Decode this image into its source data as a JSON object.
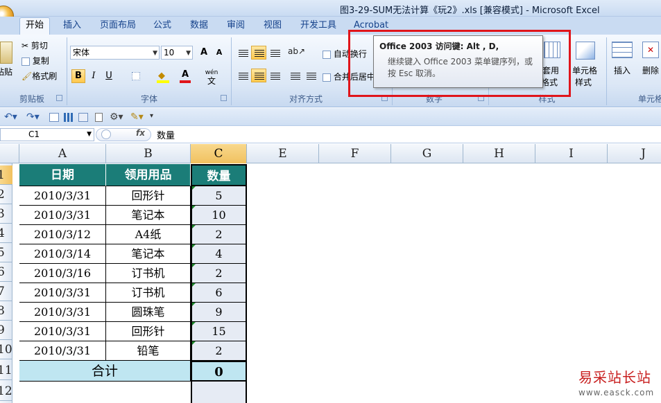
{
  "window": {
    "title": "图3-29-SUM无法计算《玩2》.xls [兼容模式] - Microsoft Excel"
  },
  "tabs": [
    "开始",
    "插入",
    "页面布局",
    "公式",
    "数据",
    "审阅",
    "视图",
    "开发工具",
    "Acrobat"
  ],
  "active_tab": "开始",
  "ribbon": {
    "clipboard": {
      "label": "剪贴板",
      "paste": "粘贴",
      "cut": "剪切",
      "copy": "复制",
      "format_painter": "格式刷"
    },
    "font": {
      "label": "字体",
      "font_name": "宋体",
      "font_size": "10",
      "bold": "B",
      "italic": "I",
      "underline": "U",
      "grow": "A",
      "shrink": "A",
      "font_color": "A",
      "phonetic": "wén"
    },
    "alignment": {
      "label": "对齐方式",
      "wrap_text": "自动换行",
      "merge_center": "合并后居中"
    },
    "number": {
      "label": "数字"
    },
    "styles": {
      "label": "样式",
      "table_format_1": "套用",
      "table_format_2": "表格格式",
      "cell_styles_1": "单元格",
      "cell_styles_2": "样式"
    },
    "cells": {
      "label": "单元格",
      "insert": "插入",
      "delete": "删除"
    }
  },
  "tooltip": {
    "title": "Office 2003 访问键: Alt , D,",
    "body": "继续键入 Office 2003 菜单键序列，或按 Esc 取消。"
  },
  "formula_bar": {
    "name_box": "C1",
    "fx": "fx",
    "formula": "数量"
  },
  "columns": [
    "A",
    "B",
    "C",
    "E",
    "F",
    "G",
    "H",
    "I",
    "J"
  ],
  "rows": [
    "1",
    "2",
    "3",
    "4",
    "5",
    "6",
    "7",
    "8",
    "9",
    "10",
    "11",
    "12"
  ],
  "table": {
    "headers": [
      "日期",
      "领用用品",
      "数量"
    ],
    "rows": [
      [
        "2010/3/31",
        "回形针",
        "5"
      ],
      [
        "2010/3/31",
        "笔记本",
        "10"
      ],
      [
        "2010/3/12",
        "A4纸",
        "2"
      ],
      [
        "2010/3/14",
        "笔记本",
        "4"
      ],
      [
        "2010/3/16",
        "订书机",
        "2"
      ],
      [
        "2010/3/31",
        "订书机",
        "6"
      ],
      [
        "2010/3/31",
        "圆珠笔",
        "9"
      ],
      [
        "2010/3/31",
        "回形针",
        "15"
      ],
      [
        "2010/3/31",
        "铅笔",
        "2"
      ]
    ],
    "total_label": "合计",
    "total_value": "0"
  },
  "watermark": {
    "text": "易采站长站",
    "url": "www.easck.com"
  },
  "colors": {
    "header_fill": "#1b7d78",
    "total_fill": "#bfe6f1",
    "highlight_box": "#e0151b"
  }
}
